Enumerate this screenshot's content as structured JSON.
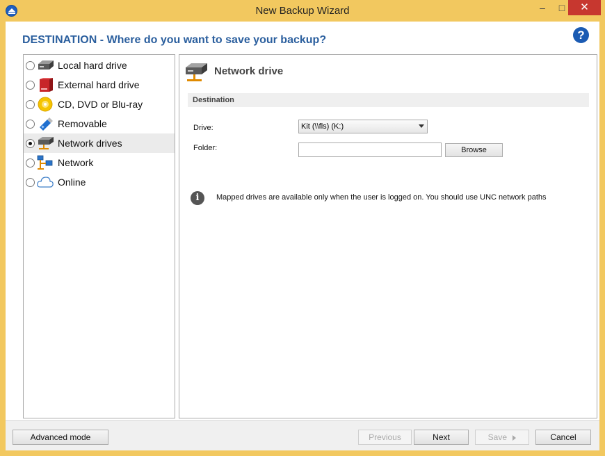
{
  "window": {
    "title": "New Backup Wizard",
    "minimize_glyph": "–",
    "maximize_glyph": "□",
    "close_glyph": "✕"
  },
  "header": {
    "title": "DESTINATION - Where do you want to save your backup?",
    "help_glyph": "?"
  },
  "destinations": [
    {
      "label": "Local hard drive",
      "icon": "hard-drive-icon",
      "selected": false
    },
    {
      "label": "External hard drive",
      "icon": "external-drive-icon",
      "selected": false
    },
    {
      "label": "CD, DVD or Blu-ray",
      "icon": "disc-icon",
      "selected": false
    },
    {
      "label": "Removable",
      "icon": "usb-drive-icon",
      "selected": false
    },
    {
      "label": "Network drives",
      "icon": "network-drive-icon",
      "selected": true
    },
    {
      "label": "Network",
      "icon": "network-icon",
      "selected": false
    },
    {
      "label": "Online",
      "icon": "cloud-icon",
      "selected": false
    }
  ],
  "panel": {
    "title": "Network drive",
    "section": "Destination",
    "drive_label": "Drive:",
    "drive_value": "Kit (\\\\fls) (K:)",
    "folder_label": "Folder:",
    "folder_value": "",
    "browse_label": "Browse",
    "info_glyph": "i",
    "info_text": "Mapped drives are available only when the user is logged on. You should use UNC network paths"
  },
  "footer": {
    "advanced_label": "Advanced mode",
    "previous_label": "Previous",
    "next_label": "Next",
    "save_label": "Save",
    "cancel_label": "Cancel"
  },
  "colors": {
    "frame": "#f2c85f",
    "heading": "#2b5f9e",
    "help": "#1b5bb3",
    "close": "#c7372f"
  }
}
